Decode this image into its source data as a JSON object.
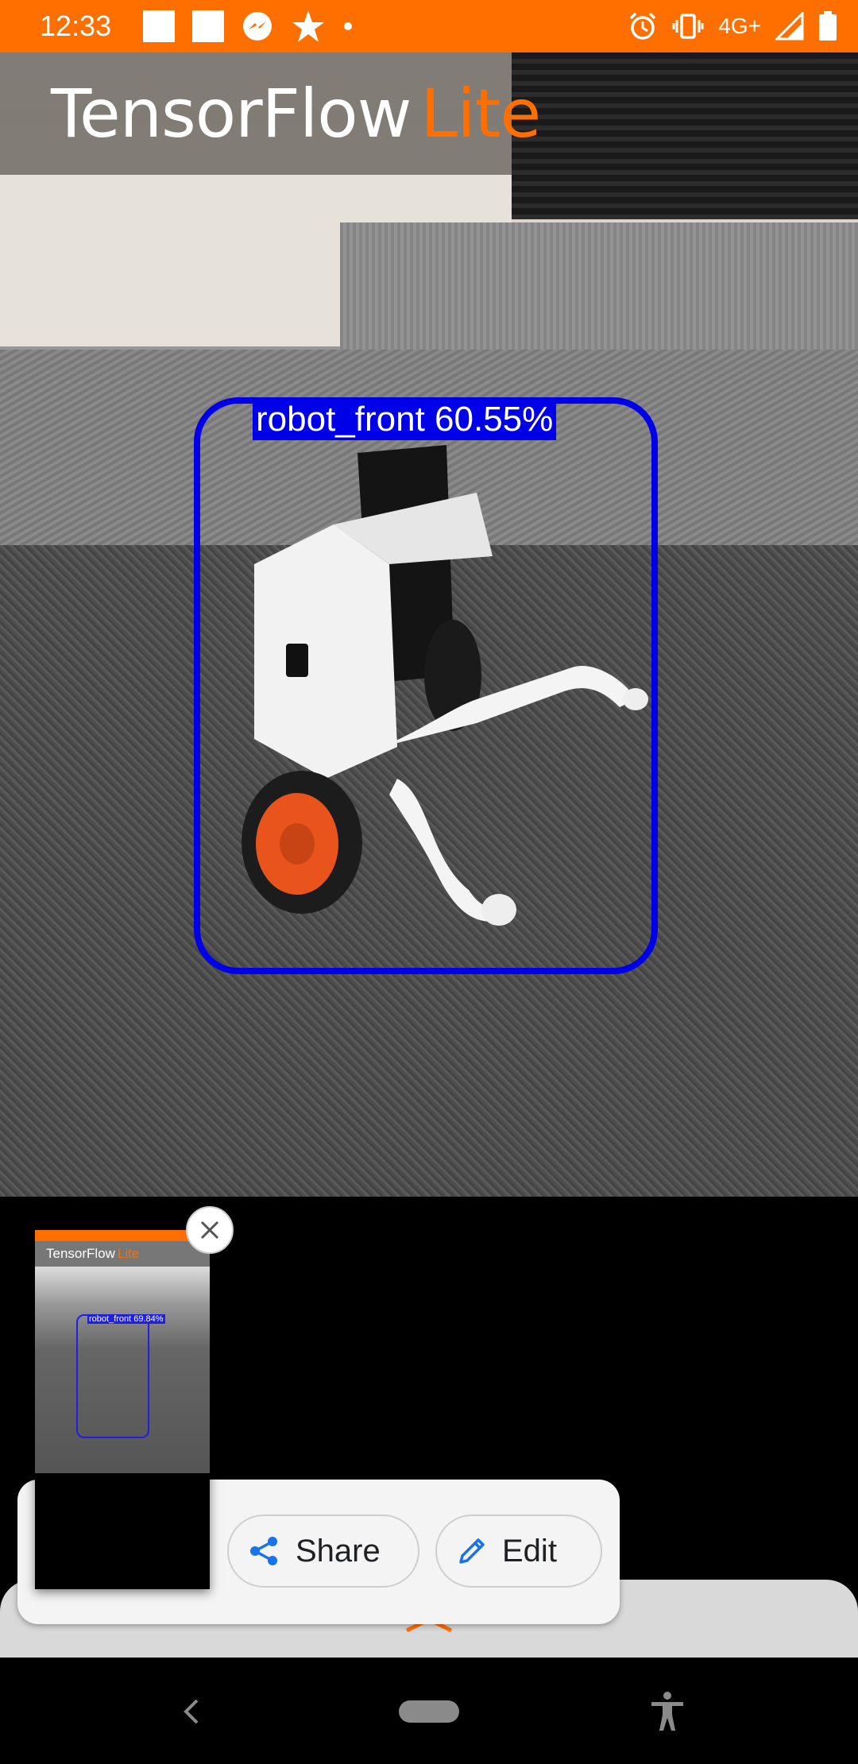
{
  "status_bar": {
    "time": "12:33",
    "network": "4G+",
    "icons": [
      "square-icon",
      "square-icon",
      "messenger-icon",
      "pinwheel-icon",
      "dot-icon",
      "alarm-icon",
      "vibrate-icon",
      "signal-icon",
      "battery-icon"
    ]
  },
  "banner": {
    "brand": "TensorFlow",
    "brand_suffix": "Lite"
  },
  "detection": {
    "label": "robot_front 60.55%",
    "color": "#0000E8"
  },
  "preview": {
    "brand": "TensorFlow",
    "brand_suffix": "Lite",
    "label": "robot_front 69.84%"
  },
  "actions": {
    "share_label": "Share",
    "edit_label": "Edit"
  },
  "colors": {
    "accent": "#FF6F00",
    "action_icon": "#1A73E8"
  }
}
